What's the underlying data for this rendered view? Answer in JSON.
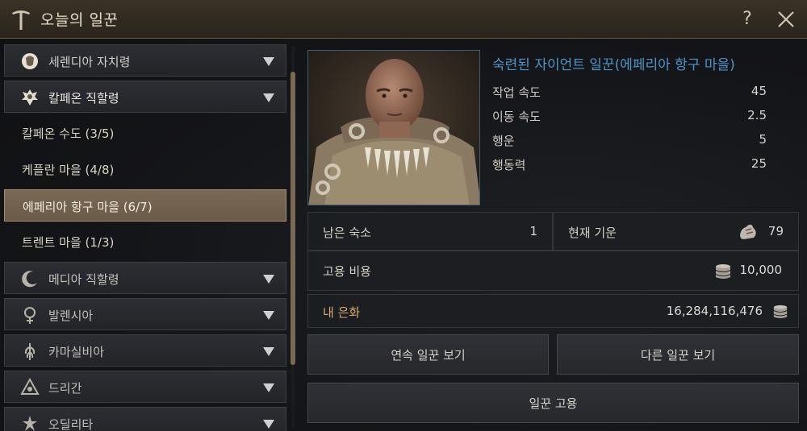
{
  "window": {
    "title": "오늘의 일꾼",
    "help_label": "?",
    "icons": {
      "title": "pickaxe-icon",
      "close": "close-icon"
    }
  },
  "regions": [
    {
      "label": "세렌디아 자치령",
      "icon": "serendia-crest-icon",
      "open": false
    },
    {
      "label": "칼페온 직할령",
      "icon": "calpheon-crest-icon",
      "open": true
    },
    {
      "label": "메디아 직할령",
      "icon": "mediah-crest-icon",
      "open": false
    },
    {
      "label": "발렌시아",
      "icon": "valencia-crest-icon",
      "open": false
    },
    {
      "label": "카마실비아",
      "icon": "kamasylvia-crest-icon",
      "open": false
    },
    {
      "label": "드리간",
      "icon": "drieghan-crest-icon",
      "open": false
    },
    {
      "label": "오딜리타",
      "icon": "odyllita-crest-icon",
      "open": false
    }
  ],
  "towns": [
    {
      "label": "칼페온 수도 (3/5)",
      "selected": false
    },
    {
      "label": "케플란 마을 (4/8)",
      "selected": false
    },
    {
      "label": "에페리아 항구 마을 (6/7)",
      "selected": true
    },
    {
      "label": "트렌트 마을 (1/3)",
      "selected": false
    }
  ],
  "worker": {
    "name": "숙련된 자이언트 일꾼(에페리아 항구 마을)",
    "stats": [
      {
        "label": "작업 속도",
        "value": "45"
      },
      {
        "label": "이동 속도",
        "value": "2.5"
      },
      {
        "label": "행운",
        "value": "5"
      },
      {
        "label": "행동력",
        "value": "25"
      }
    ]
  },
  "info": {
    "lodging_label": "남은 숙소",
    "lodging_value": "1",
    "energy_label": "현재 기운",
    "energy_value": "79",
    "cost_label": "고용 비용",
    "cost_value": "10,000",
    "silver_label": "내 은화",
    "silver_value": "16,284,116,476"
  },
  "buttons": {
    "consecutive": "연속 일꾼 보기",
    "other": "다른 일꾼 보기",
    "hire": "일꾼 고용"
  },
  "colors": {
    "accent_blue": "#4e95c9",
    "selected_bg": "#6f5e4b",
    "title_bar": "#2f281f"
  }
}
